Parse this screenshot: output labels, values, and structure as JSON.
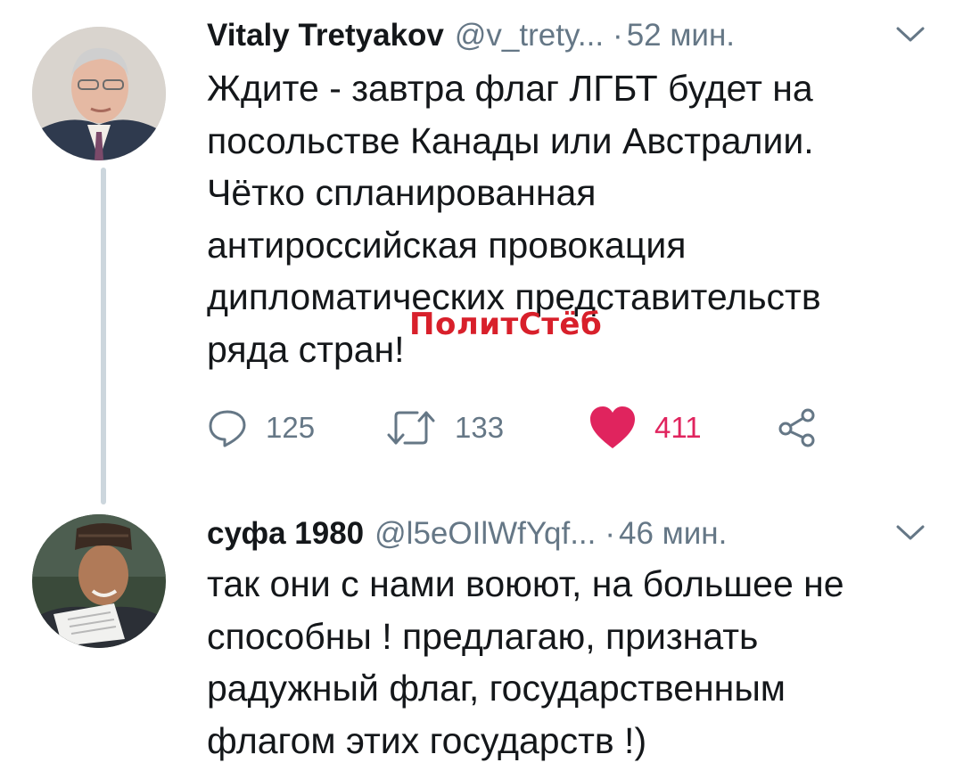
{
  "tweets": [
    {
      "author_name": "Vitaly Tretyakov",
      "handle": "@v_trety...",
      "separator": "·",
      "time": "52 мин.",
      "text": "Ждите - завтра флаг ЛГБТ будет на\nпосольстве Канады или Австралии.\nЧётко спланированная\nантироссийская провокация\nдипломатических представительств\nряда стран!",
      "replies": "125",
      "retweets": "133",
      "likes": "411",
      "liked": true
    },
    {
      "author_name": "суфа 1980",
      "handle": "@l5eOIlWfYqf...",
      "separator": "·",
      "time": "46 мин.",
      "text": "так они с нами воюют, на большее не\nспособны ! предлагаю, признать\nрадужный флаг, государственным\nфлагом этих государств !)"
    }
  ],
  "watermark": "ПолитСтёб",
  "colors": {
    "text": "#14171a",
    "secondary": "#657786",
    "like": "#e0245e",
    "thread_line": "#ccd6dd",
    "watermark": "#d8202b"
  },
  "icons": {
    "reply": "reply-icon",
    "retweet": "retweet-icon",
    "like": "heart-icon",
    "share": "share-icon",
    "menu": "chevron-down-icon"
  }
}
